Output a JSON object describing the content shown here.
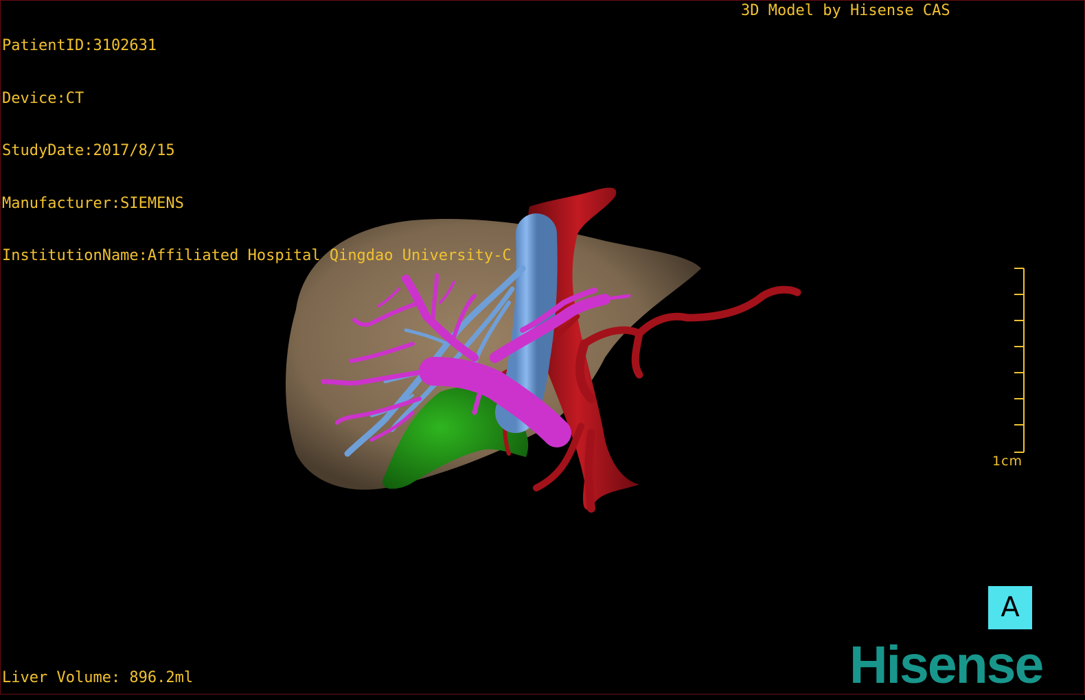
{
  "patient_info": {
    "patient_id": "PatientID:3102631",
    "device": "Device:CT",
    "study_date": "StudyDate:2017/8/15",
    "manufacturer": "Manufacturer:SIEMENS",
    "institution": "InstitutionName:Affiliated Hospital Qingdao University-C"
  },
  "credit": "3D Model by Hisense CAS",
  "liver_volume": "Liver Volume: 896.2ml",
  "scale": {
    "label": "1cm"
  },
  "orientation": {
    "label": "A"
  },
  "brand": {
    "logo_text": "Hisense",
    "logo_color": "#18968c"
  },
  "model_colors": {
    "liver": "#8c7459",
    "hepatic_veins": "#6f9fd8",
    "portal_vein": "#cc33cc",
    "artery_vena_cava": "#a3121a",
    "gallbladder": "#1f8f14",
    "text": "#f2c230",
    "orientation_box": "#4fe3ee"
  }
}
